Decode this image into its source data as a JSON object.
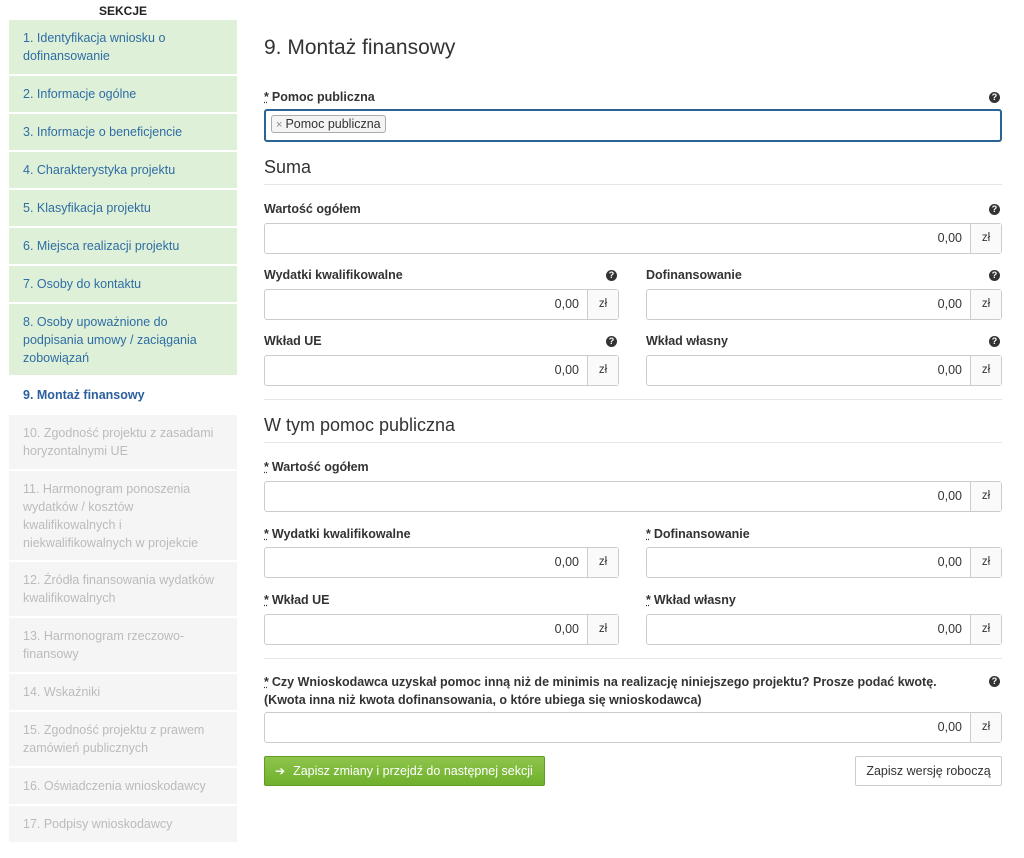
{
  "sidebar": {
    "header": "SEKCJE",
    "items": [
      {
        "label": "1. Identyfikacja wniosku o dofinansowanie",
        "state": "done"
      },
      {
        "label": "2. Informacje ogólne",
        "state": "done"
      },
      {
        "label": "3. Informacje o beneficjencie",
        "state": "done"
      },
      {
        "label": "4. Charakterystyka projektu",
        "state": "done"
      },
      {
        "label": "5. Klasyfikacja projektu",
        "state": "done"
      },
      {
        "label": "6. Miejsca realizacji projektu",
        "state": "done"
      },
      {
        "label": "7. Osoby do kontaktu",
        "state": "done"
      },
      {
        "label": "8. Osoby upoważnione do podpisania umowy / zaciągania zobowiązań",
        "state": "done"
      },
      {
        "label": "9. Montaż finansowy",
        "state": "active"
      },
      {
        "label": "10. Zgodność projektu z zasadami horyzontalnymi UE",
        "state": "todo"
      },
      {
        "label": "11. Harmonogram ponoszenia wydatków / kosztów kwalifikowalnych i niekwalifikowalnych w projekcie",
        "state": "todo"
      },
      {
        "label": "12. Źródła finansowania wydatków kwalifikowalnych",
        "state": "todo"
      },
      {
        "label": "13. Harmonogram rzeczowo-finansowy",
        "state": "todo"
      },
      {
        "label": "14. Wskaźniki",
        "state": "todo"
      },
      {
        "label": "15. Zgodność projektu z prawem zamówień publicznych",
        "state": "todo"
      },
      {
        "label": "16. Oświadczenia wnioskodawcy",
        "state": "todo"
      },
      {
        "label": "17. Podpisy wnioskodawcy",
        "state": "todo"
      }
    ]
  },
  "main": {
    "title": "9. Montaż finansowy",
    "required_mark": "*",
    "help_glyph": "?",
    "unit": "zł",
    "pomoc": {
      "label": "Pomoc publiczna",
      "tag": "Pomoc publiczna",
      "tag_remove": "×"
    },
    "suma": {
      "heading": "Suma",
      "wartosc": {
        "label": "Wartość ogółem",
        "value": "0,00"
      },
      "wydatki": {
        "label": "Wydatki kwalifikowalne",
        "value": "0,00"
      },
      "dofinansowanie": {
        "label": "Dofinansowanie",
        "value": "0,00"
      },
      "wklad_ue": {
        "label": "Wkład UE",
        "value": "0,00"
      },
      "wklad_wlasny": {
        "label": "Wkład własny",
        "value": "0,00"
      }
    },
    "pomoc_publiczna": {
      "heading": "W tym pomoc publiczna",
      "wartosc": {
        "label": "Wartość ogółem",
        "value": "0,00"
      },
      "wydatki": {
        "label": "Wydatki kwalifikowalne",
        "value": "0,00"
      },
      "dofinansowanie": {
        "label": "Dofinansowanie",
        "value": "0,00"
      },
      "wklad_ue": {
        "label": "Wkład UE",
        "value": "0,00"
      },
      "wklad_wlasny": {
        "label": "Wkład własny",
        "value": "0,00"
      }
    },
    "deminimis": {
      "label": "Czy Wnioskodawca uzyskał pomoc inną niż de minimis na realizację niniejszego projektu? Prosze podać kwotę. (Kwota inna niż kwota dofinansowania, o które ubiega się wnioskodawca)",
      "value": "0,00"
    },
    "buttons": {
      "save_next": "Zapisz zmiany i przejdź do następnej sekcji",
      "save_draft": "Zapisz wersję roboczą",
      "arrow_glyph": "➔"
    }
  }
}
